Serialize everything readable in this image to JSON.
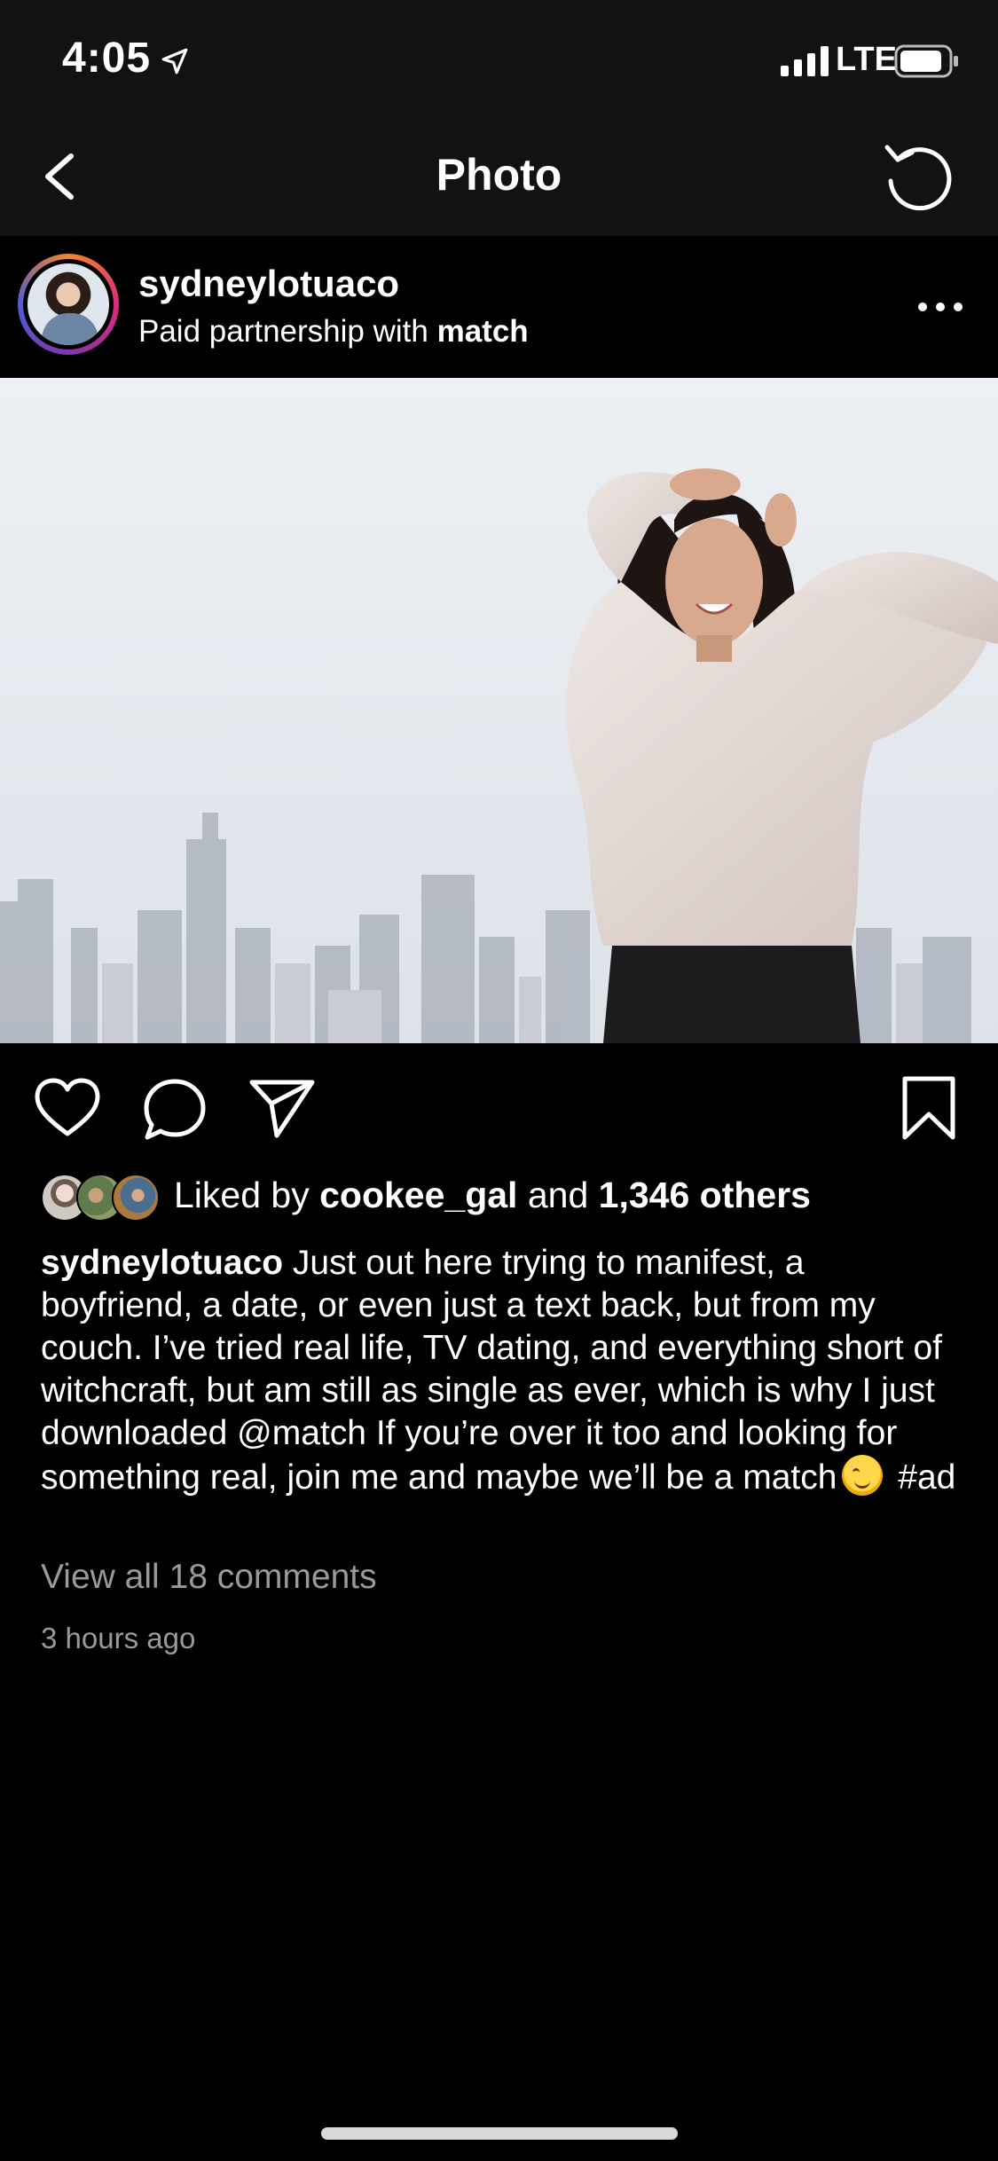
{
  "status_bar": {
    "time": "4:05",
    "network": "LTE",
    "icons": [
      "location-arrow-icon",
      "signal-bars-icon",
      "battery-icon"
    ]
  },
  "nav": {
    "title": "Photo",
    "back_icon": "chevron-left-icon",
    "refresh_icon": "refresh-icon"
  },
  "post": {
    "username": "sydneylotuaco",
    "sponsor_prefix": "Paid partnership with ",
    "sponsor_name": "match",
    "more_icon": "ellipsis-icon",
    "photo_icon": "photo-woman-city-skyline",
    "actions": [
      "heart-icon",
      "comment-icon",
      "send-icon",
      "bookmark-icon"
    ],
    "likes": {
      "prefix": "Liked by ",
      "first_liker": "cookee_gal",
      "middle": " and ",
      "others": "1,346 others"
    },
    "caption": {
      "username": "sydneylotuaco",
      "text": " Just out here trying to manifest, a boyfriend, a date, or even just a text back, but from my couch. I’ve tried real life, TV dating, and everything short of witchcraft, but am still as single as ever, which is why I just downloaded @match If you’re over it too and looking for something real, join me and maybe we’ll be a match",
      "emoji_icon": "winking-face-emoji",
      "hashtag": " #ad"
    },
    "view_comments": "View all 18 comments",
    "timestamp": "3 hours ago"
  },
  "colors": {
    "background": "#000000",
    "bar": "#121212",
    "muted_text": "#9a9a9a"
  }
}
